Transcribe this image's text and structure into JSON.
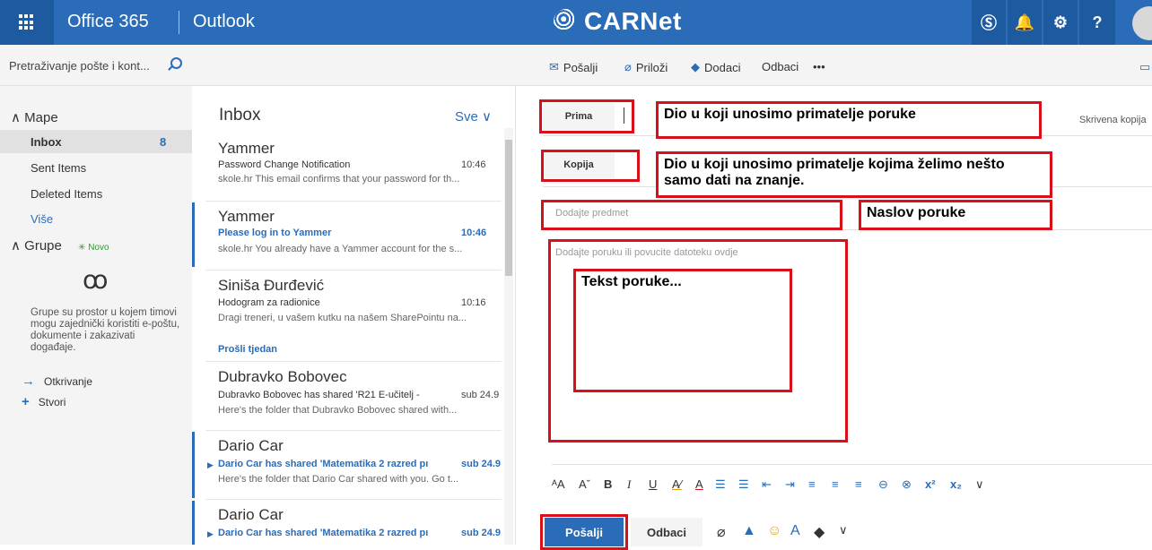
{
  "topbar": {
    "suite_name": "Office 365",
    "app_name": "Outlook",
    "brand": "CARNet",
    "icons": [
      "skype-icon",
      "bell-icon",
      "gear-icon",
      "help-icon"
    ],
    "icon_glyphs": [
      "Ⓢ",
      "🔔",
      "⚙",
      "?"
    ]
  },
  "search": {
    "placeholder": "Pretraživanje pošte i kont..."
  },
  "commands": {
    "send": "Pošalji",
    "attach": "Priloži",
    "addins": "Dodaci",
    "discard": "Odbaci",
    "more": "•••"
  },
  "nav": {
    "folders_head": "Mape",
    "items": [
      {
        "label": "Inbox",
        "count": "8"
      },
      {
        "label": "Sent Items"
      },
      {
        "label": "Deleted Items"
      }
    ],
    "more": "Više",
    "groups_head": "Grupe",
    "groups_new": "Novo",
    "groups_desc": "Grupe su prostor u kojem timovi mogu zajednički koristiti e-poštu, dokumente i zakazivati događaje.",
    "discover": "Otkrivanje",
    "create": "Stvori"
  },
  "list": {
    "title": "Inbox",
    "filter": "Sve",
    "section_label": "Prošli tjedan",
    "messages": [
      {
        "sender": "Yammer",
        "subject": "Password Change Notification",
        "time": "10:46",
        "preview": "skole.hr This email confirms that your password for th...",
        "unread": false
      },
      {
        "sender": "Yammer",
        "subject": "Please log in to Yammer",
        "time": "10:46",
        "preview": "skole.hr You already have a Yammer account for the s...",
        "unread": true
      },
      {
        "sender": "Siniša Đurđević",
        "subject": "Hodogram za radionice",
        "time": "10:16",
        "preview": "Dragi treneri, u vašem kutku na našem SharePointu na...",
        "unread": false
      },
      {
        "sender": "Dubravko Bobovec",
        "subject": "Dubravko Bobovec has shared 'R21 E-učitelj -",
        "time": "sub 24.9",
        "preview": "Here's the folder that Dubravko Bobovec shared with...",
        "unread": false
      },
      {
        "sender": "Dario Car",
        "subject": "Dario Car has shared 'Matematika 2 razred pı",
        "time": "sub 24.9",
        "preview": "Here's the folder that Dario Car shared with you. Go t...",
        "unread": true
      },
      {
        "sender": "Dario Car",
        "subject": "Dario Car has shared 'Matematika 2 razred pı",
        "time": "sub 24.9",
        "preview": "",
        "unread": true
      }
    ]
  },
  "compose": {
    "to_button": "Prima",
    "cc_button": "Kopija",
    "bcc_link": "Skrivena kopija",
    "subject_placeholder": "Dodajte predmet",
    "body_placeholder": "Dodajte poruku ili povucite datoteku ovdje",
    "send": "Pošalji",
    "discard": "Odbaci",
    "annotations": {
      "to": "Dio u koji unosimo primatelje poruke",
      "cc": "Dio u koji unosimo primatelje kojima želimo nešto samo dati na znanje.",
      "subject": "Naslov poruke",
      "body": "Tekst poruke..."
    },
    "annotation_color": "#d9101a"
  },
  "colors": {
    "accent": "#2b6cb8",
    "topbar": "#2b6cb8",
    "annotation": "#d9101a"
  }
}
